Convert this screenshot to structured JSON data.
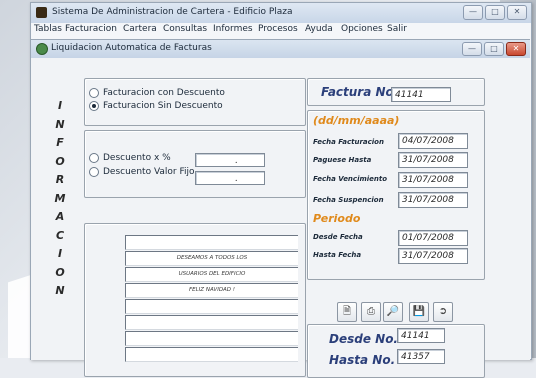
{
  "app": {
    "title": "Sistema De Administracion de Cartera - Edificio Plaza",
    "menu": [
      "Tablas",
      "Facturacion",
      "Cartera",
      "Consultas",
      "Informes",
      "Procesos",
      "Ayuda",
      "Opciones",
      "Salir"
    ]
  },
  "window": {
    "title": "Liquidacion Automatica de Facturas"
  },
  "side_label": [
    "I",
    "N",
    "F",
    "O",
    "R",
    "M",
    "A",
    "C",
    "I",
    "O",
    "N"
  ],
  "billing_type": {
    "options": [
      "Facturacion con Descuento",
      "Facturacion Sin Descuento"
    ],
    "selected": "Facturacion Sin Descuento"
  },
  "discount": {
    "percent_label": "Descuento x %",
    "fixed_label": "Descuento Valor Fijo",
    "percent_value": ".",
    "fixed_value": "."
  },
  "message_lines": [
    "",
    "DESEAMOS A TODOS LOS",
    "USUARIOS DEL EDIFICIO",
    "FELIZ NAVIDAD !",
    "",
    "",
    "",
    ""
  ],
  "invoice": {
    "label": "Factura No.",
    "number": "41141"
  },
  "dates": {
    "format_label": "(dd/mm/aaaa)",
    "fields": [
      {
        "label": "Fecha Facturacion",
        "value": "04/07/2008"
      },
      {
        "label": "Paguese Hasta",
        "value": "31/07/2008"
      },
      {
        "label": "Fecha Vencimiento",
        "value": "31/07/2008"
      },
      {
        "label": "Fecha Suspencion",
        "value": "31/07/2008"
      }
    ]
  },
  "period": {
    "label": "Periodo",
    "from_label": "Desde Fecha",
    "from_value": "01/07/2008",
    "to_label": "Hasta Fecha",
    "to_value": "31/07/2008"
  },
  "toolbar_icons": [
    "new-icon",
    "print-icon",
    "preview-icon",
    "save-icon",
    "exit-icon"
  ],
  "range": {
    "from_label": "Desde No.",
    "from_value": "41141",
    "to_label": "Hasta No.",
    "to_value": "41357"
  }
}
